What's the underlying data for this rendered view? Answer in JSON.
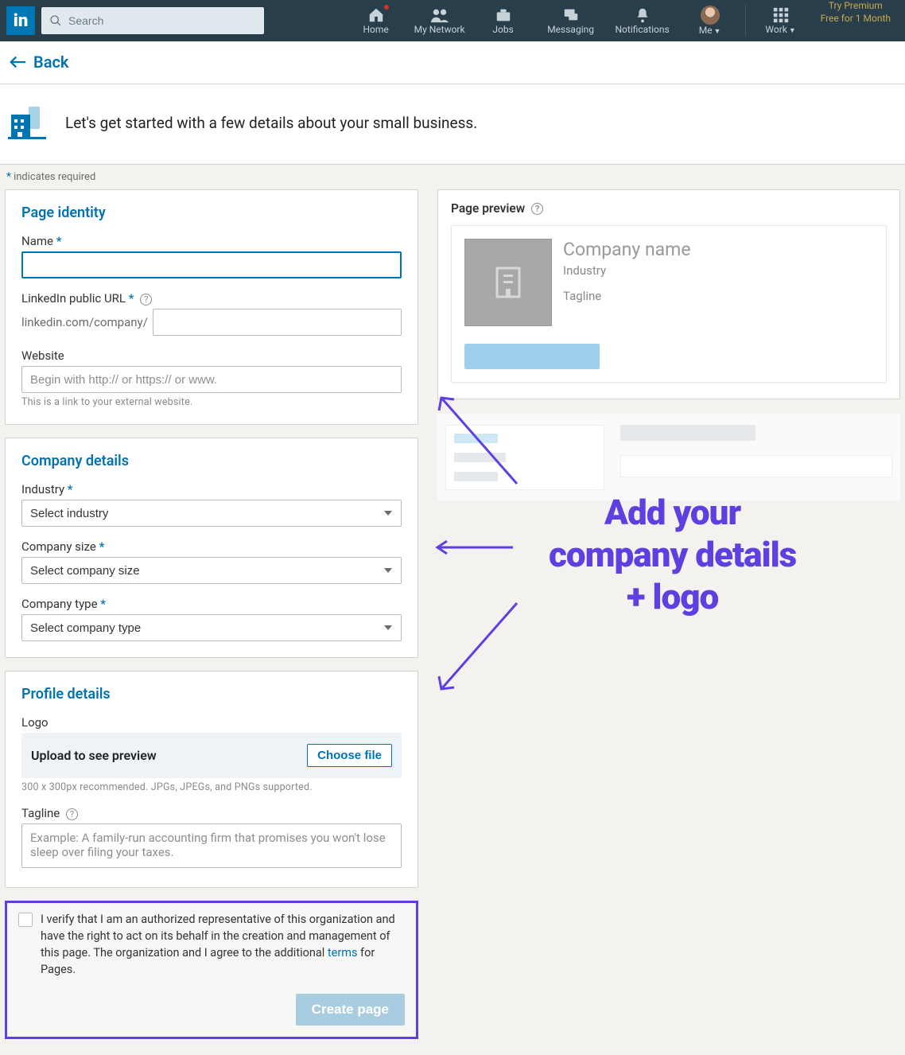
{
  "nav": {
    "search_placeholder": "Search",
    "items": {
      "home": "Home",
      "network": "My Network",
      "jobs": "Jobs",
      "messaging": "Messaging",
      "notifications": "Notifications",
      "me": "Me",
      "work": "Work"
    },
    "premium_l1": "Try Premium",
    "premium_l2": "Free for 1 Month"
  },
  "back_label": "Back",
  "intro_text": "Let's get started with a few details about your small business.",
  "required_note": "indicates required",
  "sections": {
    "identity": {
      "title": "Page identity",
      "name_label": "Name",
      "url_label": "LinkedIn public URL",
      "url_prefix": "linkedin.com/company/",
      "website_label": "Website",
      "website_placeholder": "Begin with http:// or https:// or www.",
      "website_hint": "This is a link to your external website."
    },
    "company": {
      "title": "Company details",
      "industry_label": "Industry",
      "industry_placeholder": "Select industry",
      "size_label": "Company size",
      "size_placeholder": "Select company size",
      "type_label": "Company type",
      "type_placeholder": "Select company type"
    },
    "profile": {
      "title": "Profile details",
      "logo_label": "Logo",
      "upload_text": "Upload to see preview",
      "choose_file": "Choose file",
      "logo_hint": "300 x 300px recommended. JPGs, JPEGs, and PNGs supported.",
      "tagline_label": "Tagline",
      "tagline_placeholder": "Example: A family-run accounting firm that promises you won't lose sleep over filing your taxes."
    }
  },
  "verify": {
    "text_before": "I verify that I am an authorized representative of this organization and have the right to act on its behalf in the creation and management of this page. The organization and I agree to the additional ",
    "link": "terms",
    "text_after": " for Pages.",
    "create_btn": "Create page"
  },
  "preview": {
    "title": "Page preview",
    "company_name": "Company name",
    "industry": "Industry",
    "tagline": "Tagline"
  },
  "annotation": {
    "line1": "Add your",
    "line2": "company details",
    "line3": "+ logo"
  },
  "colors": {
    "brand_blue": "#0073b1",
    "annotation_purple": "#5f3fe0",
    "nav_bg": "#283e4a"
  }
}
